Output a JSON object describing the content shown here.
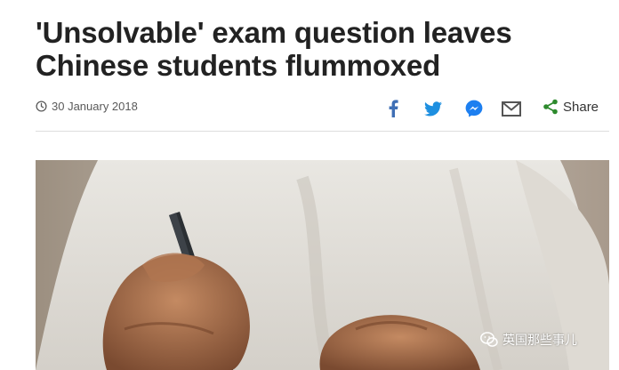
{
  "article": {
    "headline": "'Unsolvable' exam question leaves Chinese students flummoxed",
    "date": "30 January 2018"
  },
  "share": {
    "label": "Share",
    "facebook_icon": "facebook-icon",
    "twitter_icon": "twitter-icon",
    "messenger_icon": "messenger-icon",
    "email_icon": "email-icon",
    "share_icon": "share-icon",
    "accent": "#3f6fb5"
  },
  "watermark": {
    "text": "英国那些事儿"
  },
  "colors": {
    "headline": "#222222",
    "meta": "#5a5a5a",
    "divider": "#dddddd",
    "share_green": "#2d8a2d"
  }
}
